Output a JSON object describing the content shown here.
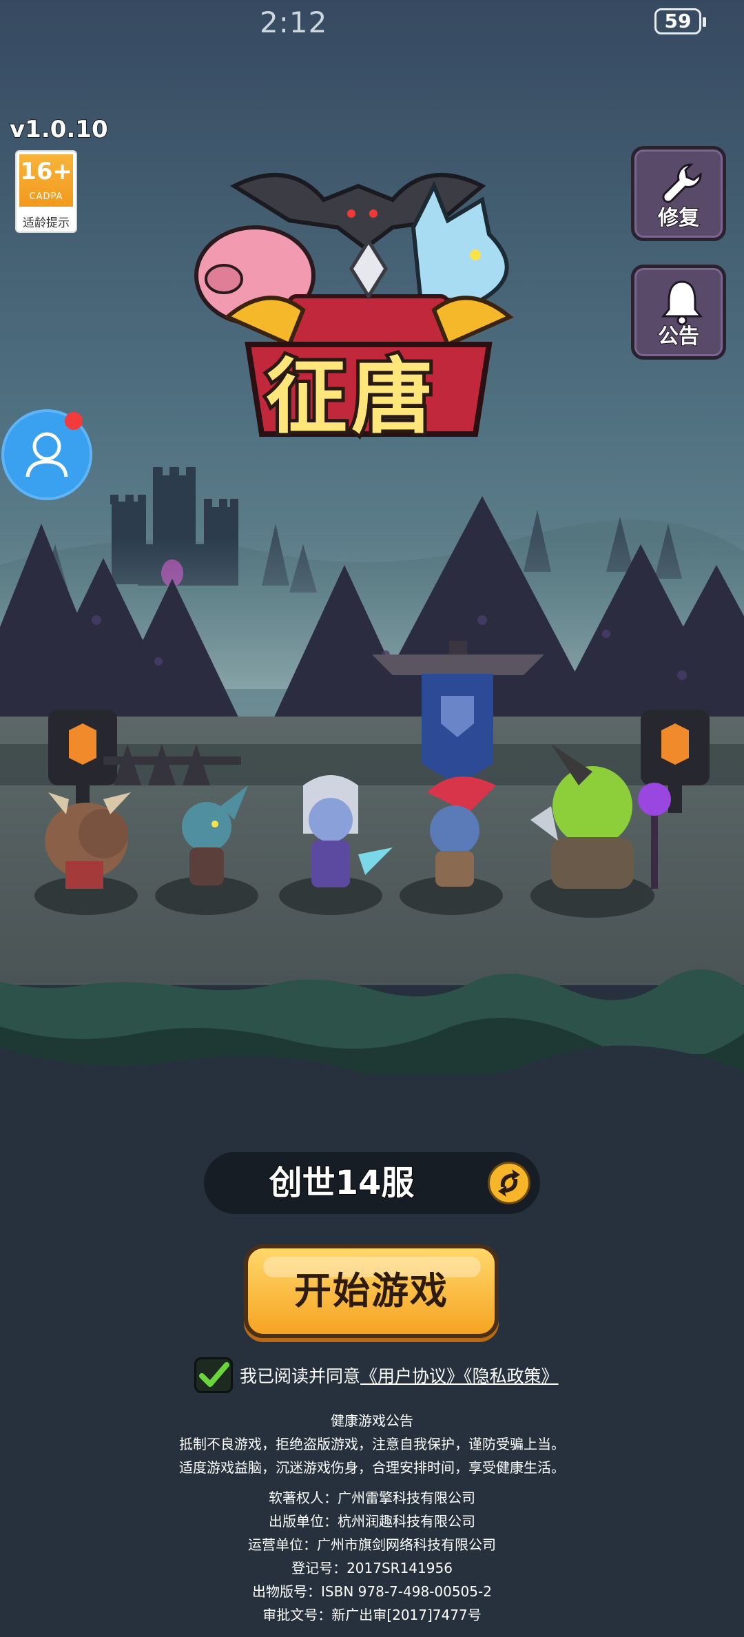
{
  "status_bar": {
    "time": "2:12",
    "battery": "59"
  },
  "game": {
    "version": "v1.0.10",
    "title": "征唐",
    "age_rating": {
      "age": "16+",
      "org": "CADPA",
      "hint": "适龄提示"
    }
  },
  "side_buttons": {
    "repair_label": "修复",
    "notice_label": "公告"
  },
  "server": {
    "name": "创世14服"
  },
  "start_button": {
    "label": "开始游戏"
  },
  "agreement": {
    "checked": true,
    "prefix": "我已阅读并同意",
    "user_agreement": "《用户协议》",
    "privacy_policy": "《隐私政策》"
  },
  "health_notice": {
    "title": "健康游戏公告",
    "line1": "抵制不良游戏，拒绝盗版游戏，注意自我保护，谨防受骗上当。",
    "line2": "适度游戏益脑，沉迷游戏伤身，合理安排时间，享受健康生活。"
  },
  "credits": {
    "copyright": "软著权人：广州雷擎科技有限公司",
    "publisher": "出版单位：杭州润趣科技有限公司",
    "operator": "运营单位：广州市旗剑网络科技有限公司",
    "registration": "登记号：2017SR141956",
    "isbn": "出物版号：ISBN 978-7-498-00505-2",
    "approval": "审批文号：新广出审[2017]7477号"
  },
  "colors": {
    "sky_top": "#3b4e63",
    "ground_dark": "#26313d",
    "start_button": "#f6a423",
    "avatar_blue": "#3aa0f0",
    "notification_red": "#f43b3b"
  }
}
